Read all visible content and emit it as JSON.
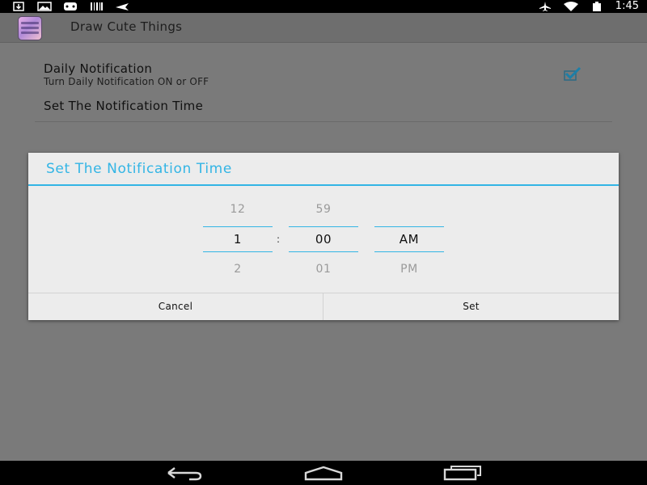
{
  "status_bar": {
    "time": "1:45",
    "left_icons": [
      "download-icon",
      "photo-icon",
      "gamepad-icon",
      "barcode-icon",
      "airplane-notification-icon"
    ],
    "right_icons": [
      "airplane-mode-icon",
      "wifi-icon",
      "battery-icon"
    ]
  },
  "action_bar": {
    "app_icon": "app-logo-icon",
    "title": "Draw Cute Things"
  },
  "preferences": {
    "daily_notification": {
      "title": "Daily Notification",
      "summary": "Turn Daily Notification ON or OFF",
      "checked": true
    },
    "set_time": {
      "title": "Set The Notification Time"
    }
  },
  "dialog": {
    "title": "Set The Notification Time",
    "separator": ":",
    "hour": {
      "prev": "12",
      "current": "1",
      "next": "2"
    },
    "minute": {
      "prev": "59",
      "current": "00",
      "next": "01"
    },
    "ampm": {
      "prev": "",
      "current": "AM",
      "next": "PM"
    },
    "cancel_label": "Cancel",
    "set_label": "Set"
  },
  "nav_bar": {
    "icons": [
      "back-icon",
      "home-icon",
      "recent-apps-icon"
    ]
  },
  "colors": {
    "accent": "#33b5e5",
    "dim_background": "#7a7a7a",
    "dialog_background": "#ececec"
  }
}
